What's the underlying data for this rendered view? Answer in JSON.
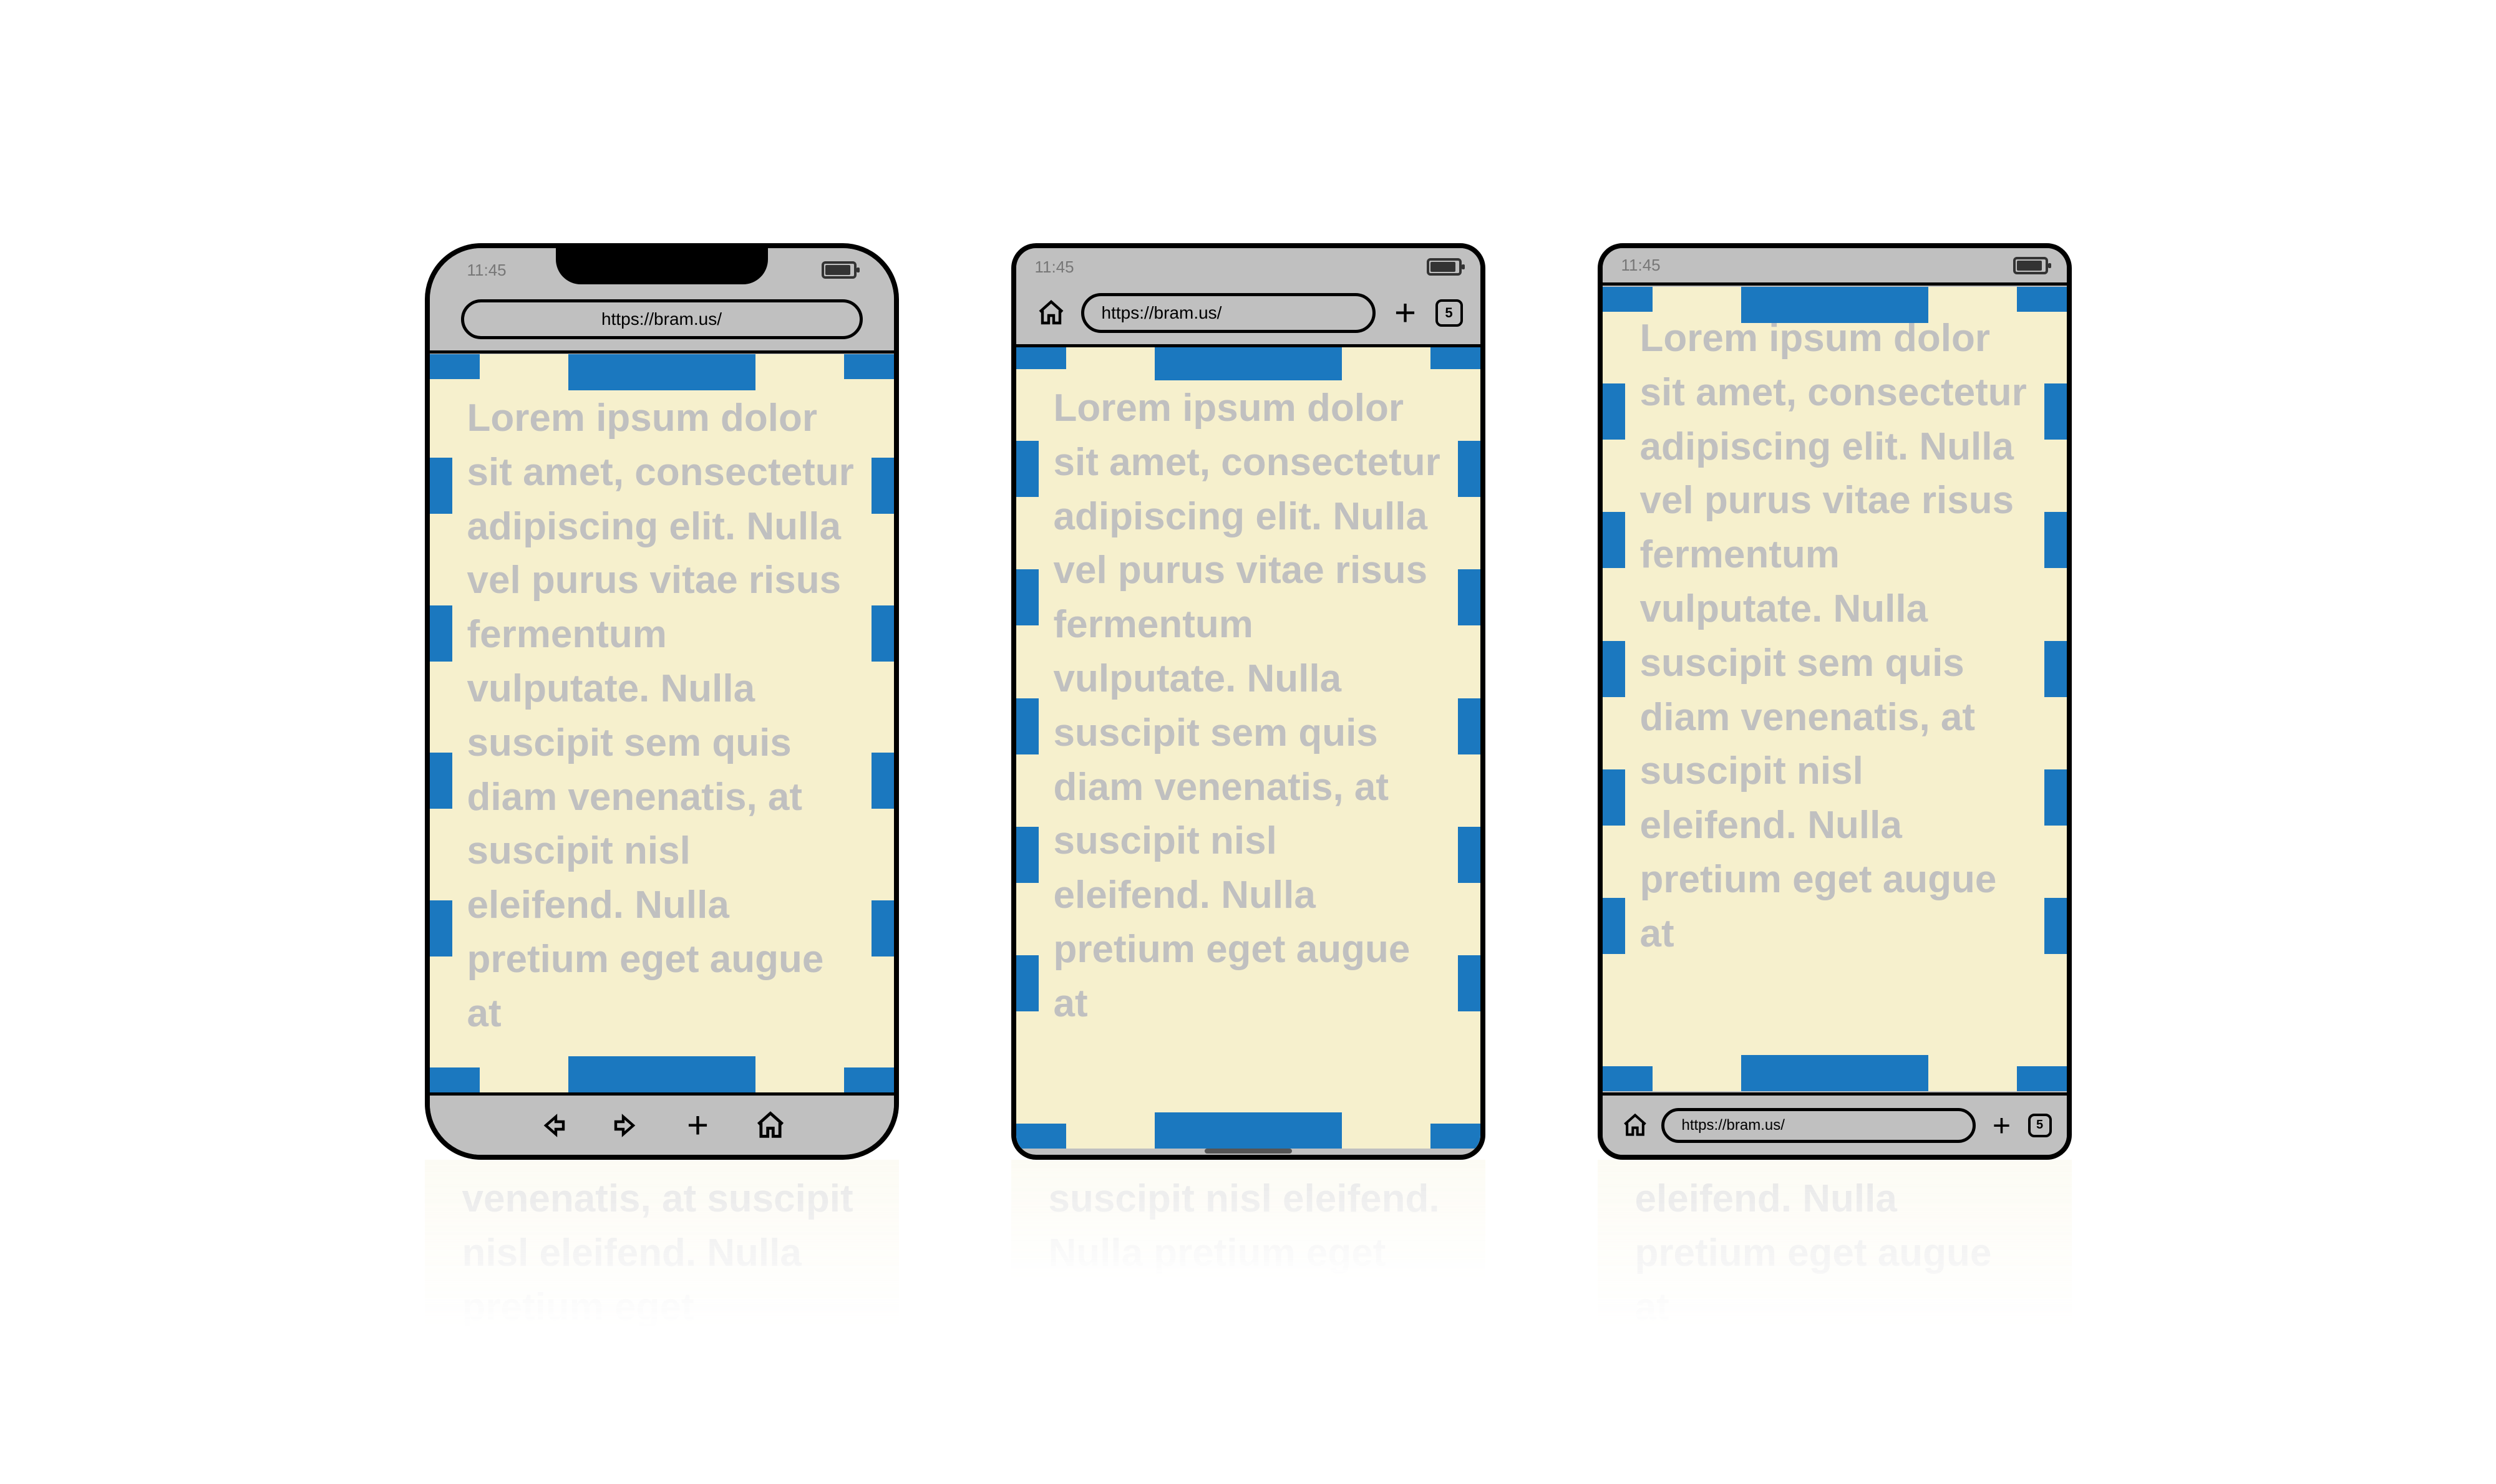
{
  "common": {
    "clock": "11:45",
    "url": "https://bram.us/",
    "tab_count": "5",
    "body_text": "Lorem ipsum dolor sit amet, consectetur adipiscing elit. Nulla vel purus vitae risus fermentum vulputate. Nulla suscipit sem quis diam venenatis, at suscipit nisl eleifend. Nulla pretium eget augue at",
    "reflection_a": "venenatis, at suscipit nisl eleifend. Nulla pretium eget",
    "reflection_b": "suscipit nisl eleifend. Nulla pretium eget",
    "reflection_c": "eleifend. Nulla pretium eget augue at"
  },
  "colors": {
    "viewport_bg": "#f6f0cd",
    "dash_blue": "#1b78bf",
    "chrome_gray": "#c0c0c0",
    "text_faded": "#c0c0c0"
  },
  "diagram_note": "Three mobile browser mockups showing the same page with viewport (cream area) outlined by dashed blue rectangle. Variant A has iOS-style rounded frame with notch, URL bar at top and navigation toolbar at bottom. Variant B has URL bar + home/plus/tabs at top and only a home indicator at bottom. Variant C has only a status bar at top and URL toolbar at bottom."
}
